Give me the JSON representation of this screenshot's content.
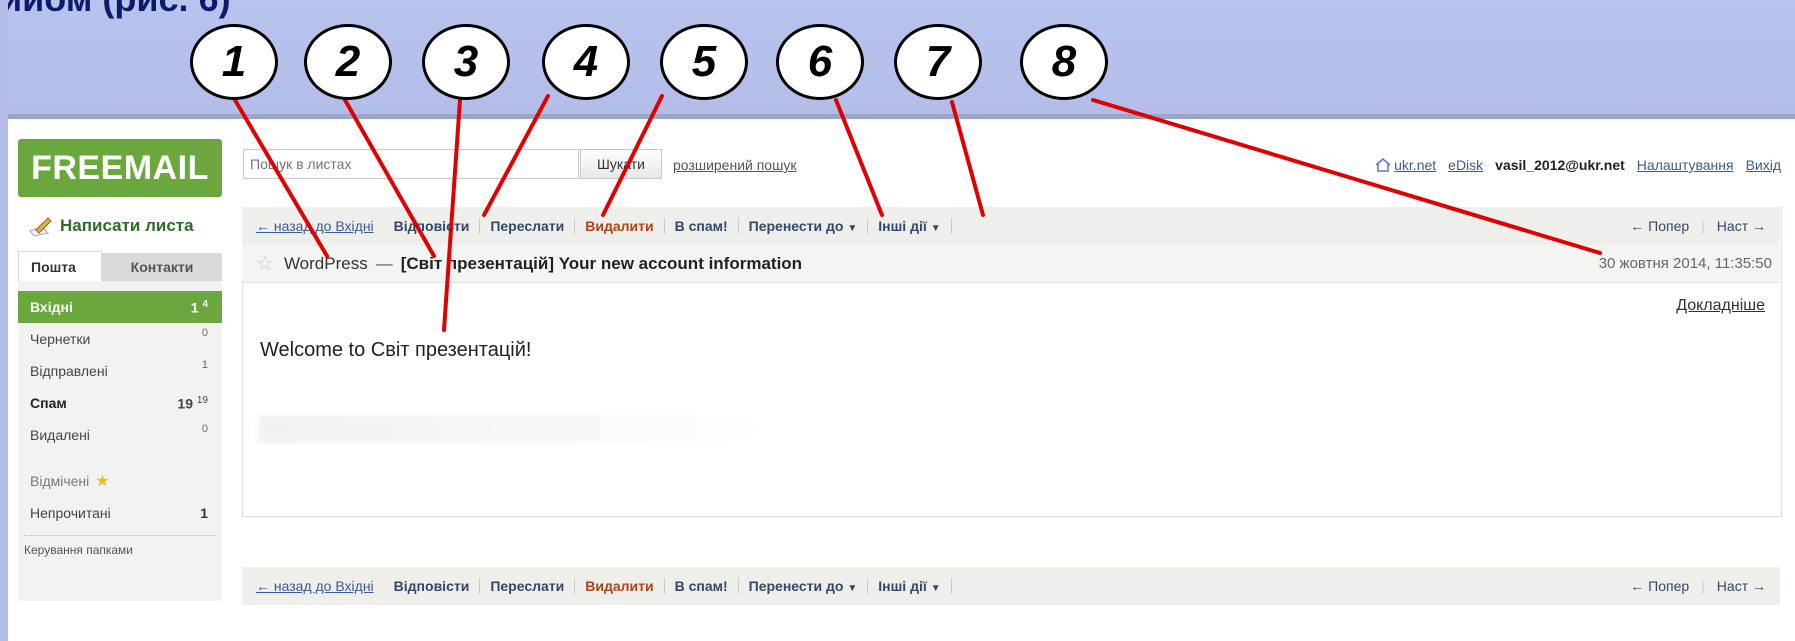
{
  "slide": {
    "title": "ийом (рис. 6)"
  },
  "callouts": [
    "1",
    "2",
    "3",
    "4",
    "5",
    "6",
    "7",
    "8"
  ],
  "logo": "FREEMAIL",
  "search": {
    "placeholder": "Пошук в листах",
    "button": "Шукати",
    "advanced": "розширений пошук"
  },
  "top_links": {
    "ukr": "ukr.net",
    "edisk": "eDisk",
    "email": "vasil_2012@ukr.net",
    "settings": "Налаштування",
    "logout": "Вихід"
  },
  "compose": "Написати листа",
  "tabs": {
    "mail": "Пошта",
    "contacts": "Контакти"
  },
  "folders": [
    {
      "name": "Вхідні",
      "count": "1",
      "sup": "4"
    },
    {
      "name": "Чернетки",
      "count": "0"
    },
    {
      "name": "Відправлені",
      "count": "1"
    },
    {
      "name": "Спам",
      "count": "19",
      "sup": "19"
    },
    {
      "name": "Видалені",
      "count": "0"
    }
  ],
  "special": {
    "marked": "Відмічені",
    "unread": "Непрочитані",
    "unread_count": "1"
  },
  "manage_folders": "Керування папками",
  "toolbar": {
    "back": "← назад до Вхідні",
    "reply": "Відповісти",
    "forward": "Переслати",
    "delete": "Видалити",
    "spam": "В спам!",
    "move": "Перенести до",
    "other": "Інші дії",
    "prev": "← Попер",
    "next": "Наст →"
  },
  "message": {
    "sender": "WordPress",
    "dash": "—",
    "subject": "[Світ презентацій] Your new account information",
    "date": "30 жовтня 2014, 11:35:50",
    "details": "Докладніше",
    "body": "Welcome to Світ презентацій!"
  },
  "colors": {
    "brand": "#6aa83d",
    "band": "#b3bde8",
    "annotation_line": "#e00000"
  }
}
